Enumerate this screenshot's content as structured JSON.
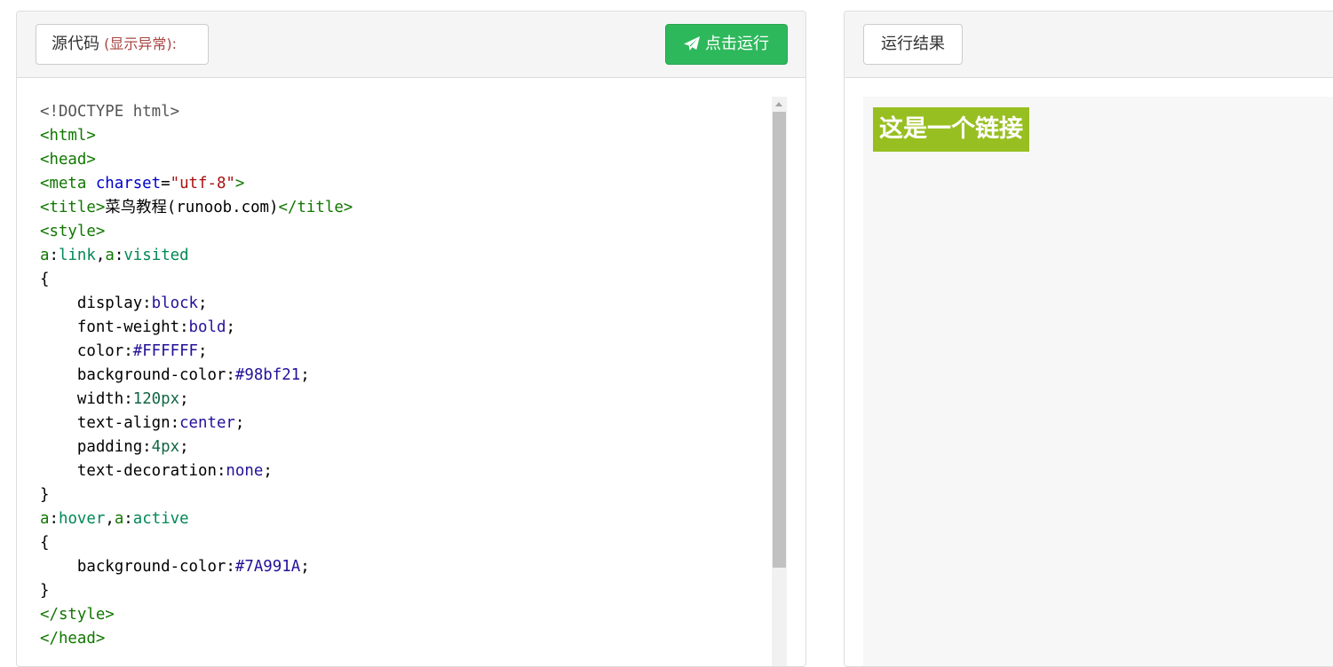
{
  "source_panel": {
    "label": "源代码",
    "warn_open": " (",
    "warn_text": "显示异常",
    "warn_close": "):",
    "run_button": "点击运行",
    "run_icon": "paper-plane-icon"
  },
  "code_lines": [
    [
      {
        "t": "<!DOCTYPE html>",
        "c": "doc"
      }
    ],
    [
      {
        "t": "<html>",
        "c": "tag"
      }
    ],
    [
      {
        "t": "<head>",
        "c": "tag"
      }
    ],
    [
      {
        "t": "<meta ",
        "c": "tag"
      },
      {
        "t": "charset",
        "c": "attr"
      },
      {
        "t": "=",
        "c": ""
      },
      {
        "t": "\"utf-8\"",
        "c": "str"
      },
      {
        "t": ">",
        "c": "tag"
      }
    ],
    [
      {
        "t": "<title>",
        "c": "tag"
      },
      {
        "t": "菜鸟教程(runoob.com)",
        "c": ""
      },
      {
        "t": "</title>",
        "c": "tag"
      }
    ],
    [
      {
        "t": "<style>",
        "c": "tag"
      }
    ],
    [
      {
        "t": "a",
        "c": "sel"
      },
      {
        "t": ":",
        "c": ""
      },
      {
        "t": "link",
        "c": "pseudo"
      },
      {
        "t": ",",
        "c": ""
      },
      {
        "t": "a",
        "c": "sel"
      },
      {
        "t": ":",
        "c": ""
      },
      {
        "t": "visited",
        "c": "pseudo"
      }
    ],
    [
      {
        "t": "{",
        "c": ""
      }
    ],
    [
      {
        "t": "    display",
        "c": "prop"
      },
      {
        "t": ":",
        "c": ""
      },
      {
        "t": "block",
        "c": "kw"
      },
      {
        "t": ";",
        "c": ""
      }
    ],
    [
      {
        "t": "    font-weight",
        "c": "prop"
      },
      {
        "t": ":",
        "c": ""
      },
      {
        "t": "bold",
        "c": "kw"
      },
      {
        "t": ";",
        "c": ""
      }
    ],
    [
      {
        "t": "    color",
        "c": "prop"
      },
      {
        "t": ":",
        "c": ""
      },
      {
        "t": "#FFFFFF",
        "c": "color"
      },
      {
        "t": ";",
        "c": ""
      }
    ],
    [
      {
        "t": "    background-color",
        "c": "prop"
      },
      {
        "t": ":",
        "c": ""
      },
      {
        "t": "#98bf21",
        "c": "color"
      },
      {
        "t": ";",
        "c": ""
      }
    ],
    [
      {
        "t": "    width",
        "c": "prop"
      },
      {
        "t": ":",
        "c": ""
      },
      {
        "t": "120px",
        "c": "num"
      },
      {
        "t": ";",
        "c": ""
      }
    ],
    [
      {
        "t": "    text-align",
        "c": "prop"
      },
      {
        "t": ":",
        "c": ""
      },
      {
        "t": "center",
        "c": "kw"
      },
      {
        "t": ";",
        "c": ""
      }
    ],
    [
      {
        "t": "    padding",
        "c": "prop"
      },
      {
        "t": ":",
        "c": ""
      },
      {
        "t": "4px",
        "c": "num"
      },
      {
        "t": ";",
        "c": ""
      }
    ],
    [
      {
        "t": "    text-decoration",
        "c": "prop"
      },
      {
        "t": ":",
        "c": ""
      },
      {
        "t": "none",
        "c": "kw"
      },
      {
        "t": ";",
        "c": ""
      }
    ],
    [
      {
        "t": "}",
        "c": ""
      }
    ],
    [
      {
        "t": "a",
        "c": "sel"
      },
      {
        "t": ":",
        "c": ""
      },
      {
        "t": "hover",
        "c": "pseudo"
      },
      {
        "t": ",",
        "c": ""
      },
      {
        "t": "a",
        "c": "sel"
      },
      {
        "t": ":",
        "c": ""
      },
      {
        "t": "active",
        "c": "pseudo"
      }
    ],
    [
      {
        "t": "{",
        "c": ""
      }
    ],
    [
      {
        "t": "    background-color",
        "c": "prop"
      },
      {
        "t": ":",
        "c": ""
      },
      {
        "t": "#7A991A",
        "c": "color"
      },
      {
        "t": ";",
        "c": ""
      }
    ],
    [
      {
        "t": "}",
        "c": ""
      }
    ],
    [
      {
        "t": "</style>",
        "c": "tag"
      }
    ],
    [
      {
        "t": "</head>",
        "c": "tag"
      }
    ]
  ],
  "result_panel": {
    "label": "运行结果",
    "link_text": "这是一个链接",
    "link_background": "#98bf21",
    "link_color": "#FFFFFF"
  },
  "colors": {
    "run_button": "#2eb85c",
    "warn_text": "#a94442"
  }
}
